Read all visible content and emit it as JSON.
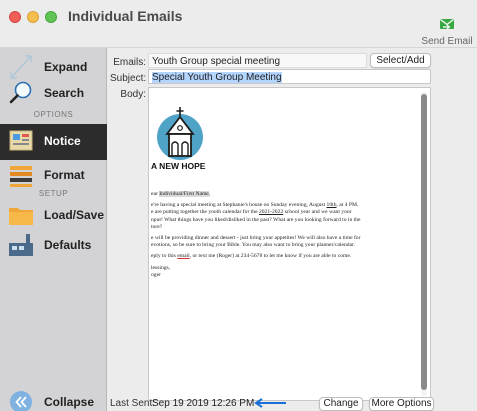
{
  "window": {
    "title": "Individual Emails",
    "send_email_label": "Send Email"
  },
  "sidebar": {
    "items": {
      "expand": "Expand",
      "search": "Search",
      "notice": "Notice",
      "format": "Format",
      "load_save": "Load/Save",
      "defaults": "Defaults",
      "collapse": "Collapse"
    },
    "sections": {
      "options": "OPTIONS",
      "setup": "SETUP"
    },
    "active_item": "Notice"
  },
  "form": {
    "emails_label": "Emails:",
    "emails_value": "Youth Group special meeting",
    "select_add_label": "Select/Add",
    "subject_label": "Subject:",
    "subject_value": "Special Youth Group Meeting",
    "body_label": "Body:"
  },
  "body": {
    "logo_text": "A NEW HOPE",
    "greeting_prefix": "ear ",
    "greeting_merge": "Individual/First Name",
    "greeting_suffix": ",",
    "p1_a": "e're having a special meeting at Stephanie's house on Sunday evening, August ",
    "p1_date": "10th",
    "p1_b": ", at 4 PM.",
    "p1_c": "e are putting together the youth calendar for the ",
    "p1_years": "2021-2022",
    "p1_d": " school year and we want your",
    "p1_e": "nput! What things have you liked/disliked in the past? What are you looking forward to in the",
    "p1_f": "ture?",
    "p2_a": "e will be providing dinner and dessert - just bring your appetites! We will also have a time for",
    "p2_b": "evotions, so be sure to bring your Bible. You may also want to bring your planner/calendar.",
    "p3_a": "eply to this ",
    "p3_email": "email",
    "p3_b": ", or text me (Roger) at 234-5678 to let me know if you are able to come.",
    "sign_1": "lessings,",
    "sign_2": "oger"
  },
  "bottom": {
    "last_sent_label": "Last Sent:",
    "last_sent_value": "Sep 19 2019 12:26 PM",
    "change_label": "Change",
    "more_options_label": "More Options"
  },
  "colors": {
    "sidebar_active_bg": "#2c2c2c",
    "selection": "#b3d4fc",
    "arrow": "#1a6fd6",
    "logo_circle": "#4fa3c7"
  },
  "icons": {
    "expand": "expand-arrows-icon",
    "search": "magnifier-icon",
    "notice": "notice-board-icon",
    "format": "format-icon",
    "load_save": "folder-icon",
    "defaults": "factory-icon",
    "collapse": "double-chevron-left-icon",
    "send_email": "envelope-arrow-icon"
  }
}
